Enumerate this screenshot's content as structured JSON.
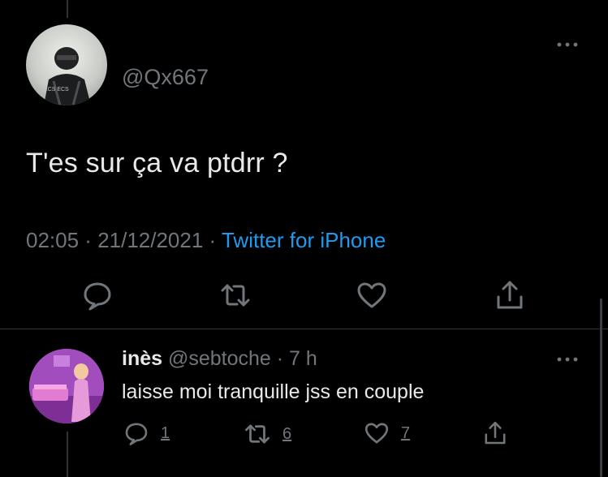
{
  "main_tweet": {
    "handle": "@Qx667",
    "text": "T'es sur ça va ptdrr ?",
    "time": "02:05",
    "separator1": " · ",
    "date": "21/12/2021",
    "separator2": " · ",
    "source": "Twitter for iPhone",
    "avatar_lettering": "ECS ECS"
  },
  "reply": {
    "name": "inès",
    "handle": "@sebtoche",
    "separator": " · ",
    "age": "7 h",
    "text": "laisse moi tranquille jss en couple",
    "counts": {
      "replies": "1",
      "retweets": "6",
      "likes": "7"
    }
  },
  "icons": [
    "more-icon",
    "reply-icon",
    "retweet-icon",
    "like-icon",
    "share-icon"
  ],
  "colors": {
    "background": "#000000",
    "text": "#e7e9ea",
    "muted": "#71767b",
    "link": "#1d9bf0",
    "divider": "#2f3336"
  }
}
